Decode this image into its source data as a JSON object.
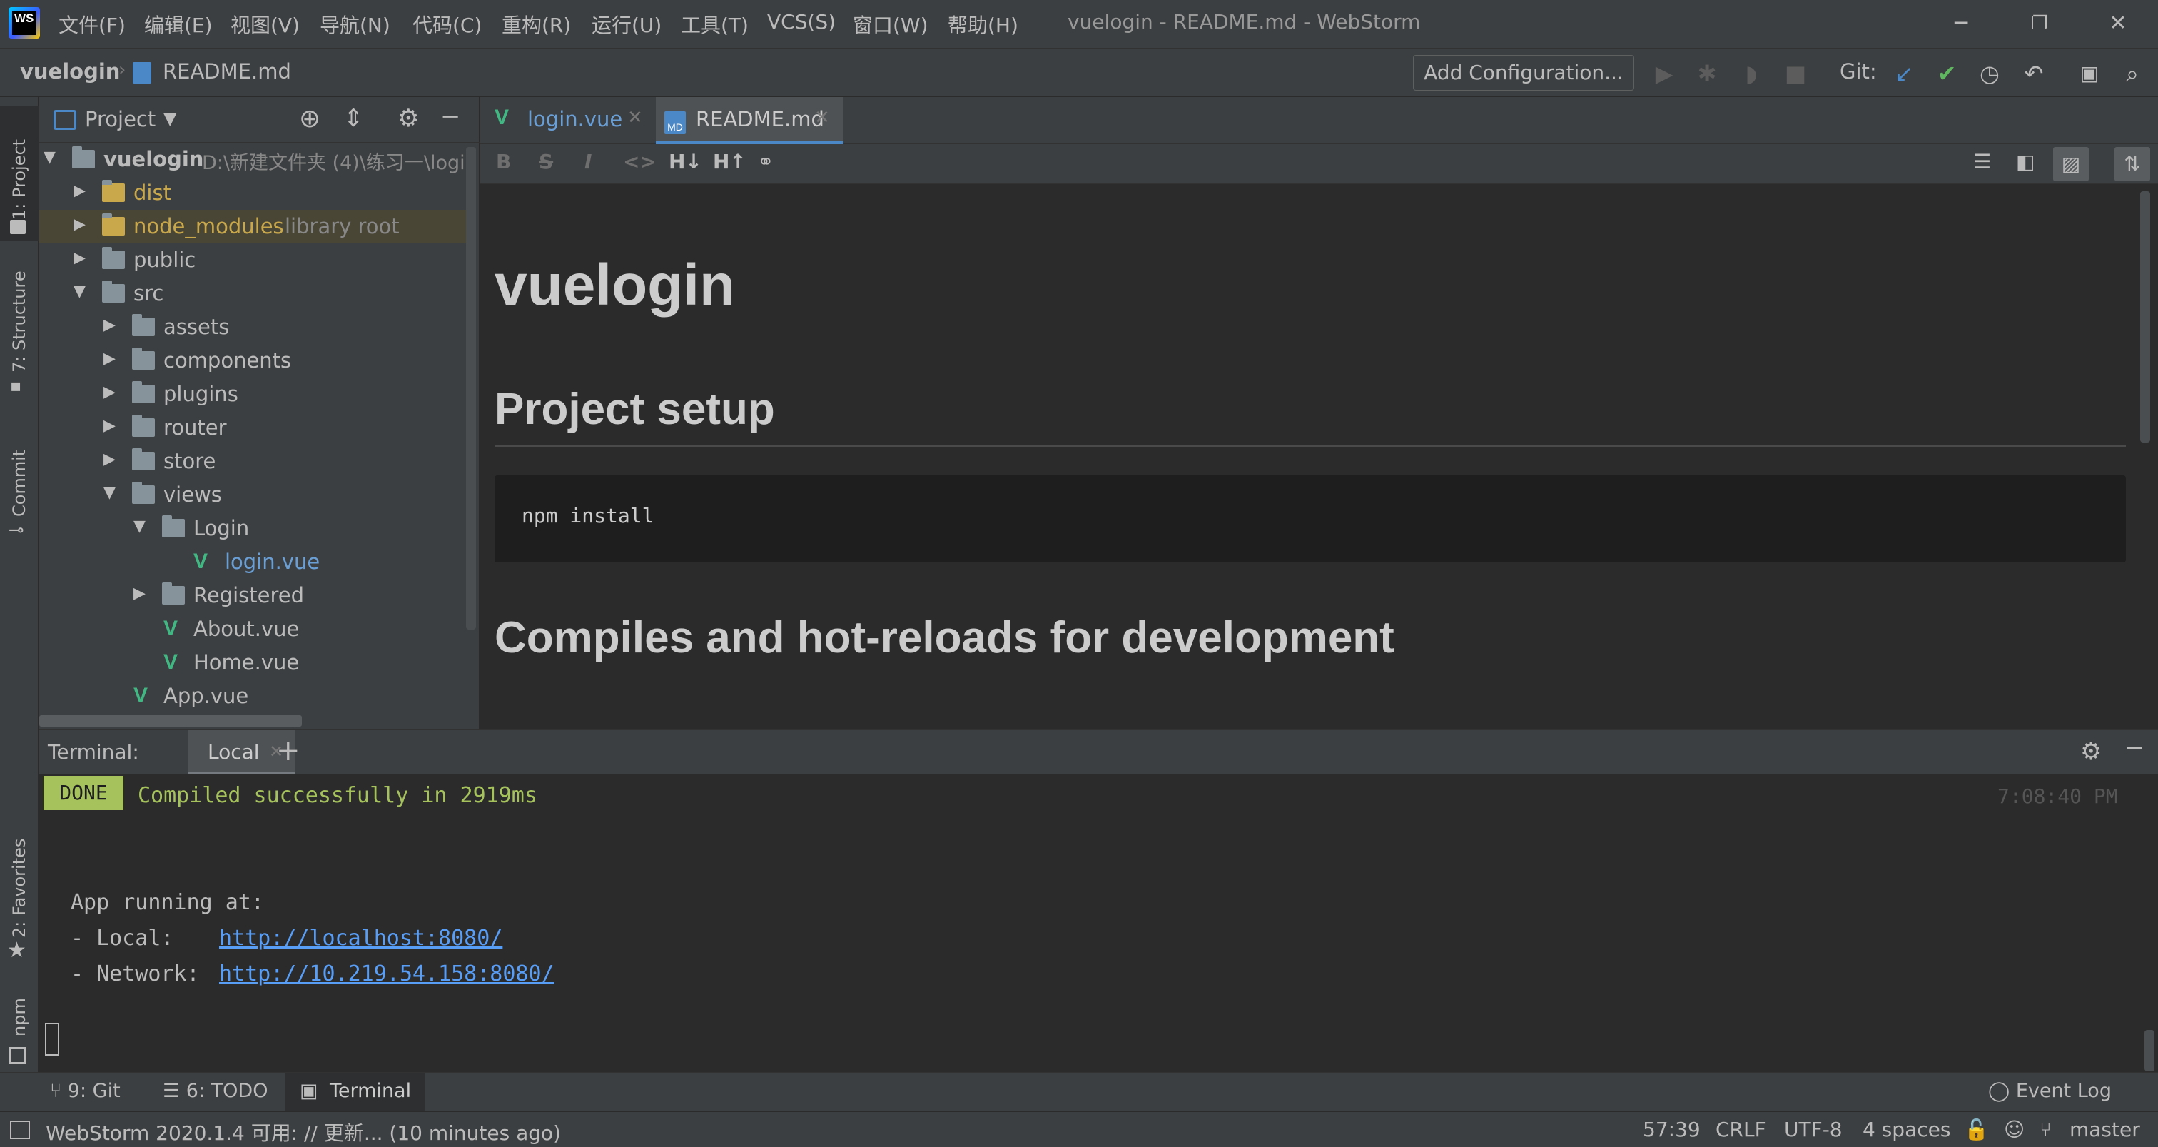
{
  "menu": [
    "文件(F)",
    "编辑(E)",
    "视图(V)",
    "导航(N)",
    "代码(C)",
    "重构(R)",
    "运行(U)",
    "工具(T)",
    "VCS(S)",
    "窗口(W)",
    "帮助(H)"
  ],
  "window_title": "vuelogin - README.md - WebStorm",
  "logo_text": "WS",
  "breadcrumb": {
    "project": "vuelogin",
    "file": "README.md"
  },
  "toolbar": {
    "add_config": "Add Configuration...",
    "git_label": "Git:"
  },
  "left_stripe": {
    "project": "1: Project",
    "structure": "7: Structure",
    "commit": "Commit",
    "favorites": "2: Favorites",
    "npm": "npm"
  },
  "project_panel": {
    "title": "Project",
    "root": {
      "name": "vuelogin",
      "path": "D:\\新建文件夹 (4)\\练习一\\logi"
    },
    "items": [
      {
        "label": "dist",
        "extra": ""
      },
      {
        "label": "node_modules",
        "extra": "library root"
      },
      {
        "label": "public",
        "extra": ""
      },
      {
        "label": "src",
        "extra": ""
      },
      {
        "label": "assets",
        "extra": ""
      },
      {
        "label": "components",
        "extra": ""
      },
      {
        "label": "plugins",
        "extra": ""
      },
      {
        "label": "router",
        "extra": ""
      },
      {
        "label": "store",
        "extra": ""
      },
      {
        "label": "views",
        "extra": ""
      },
      {
        "label": "Login",
        "extra": ""
      },
      {
        "label": "login.vue",
        "extra": ""
      },
      {
        "label": "Registered",
        "extra": ""
      },
      {
        "label": "About.vue",
        "extra": ""
      },
      {
        "label": "Home.vue",
        "extra": ""
      },
      {
        "label": "App.vue",
        "extra": ""
      }
    ]
  },
  "editor_tabs": [
    {
      "label": "login.vue",
      "active": false
    },
    {
      "label": "README.md",
      "active": true
    }
  ],
  "md_icon_text": "MD",
  "md_toolbar": {
    "bold": "B",
    "strike": "S",
    "italic": "I",
    "code": "<>",
    "h_down": "H↓",
    "h_up": "H↑"
  },
  "readme": {
    "h1": "vuelogin",
    "h2_setup": "Project setup",
    "code": "npm install",
    "h2_compile": "Compiles and hot-reloads for development"
  },
  "terminal": {
    "label": "Terminal:",
    "tab": "Local",
    "done_badge": "DONE",
    "compiled": "Compiled successfully in 2919ms",
    "time": "7:08:40 PM",
    "running": "App running at:",
    "local_label": "- Local:   ",
    "local_url": "http://localhost:8080/",
    "network_label": "- Network: ",
    "network_url": "http://10.219.54.158:8080/"
  },
  "bottom_tabs": {
    "git": "9: Git",
    "todo": "6: TODO",
    "terminal": "Terminal",
    "event_log": "Event Log"
  },
  "status": {
    "message": "WebStorm 2020.1.4 可用: // 更新... (10 minutes ago)",
    "position": "57:39",
    "line_sep": "CRLF",
    "encoding": "UTF-8",
    "indent": "4 spaces",
    "branch": "master"
  },
  "colors": {
    "accent": "#4a88c7",
    "vue_green": "#41b883",
    "done_bg": "#a5c25c",
    "compiled_text": "#a5c25c",
    "link": "#589df6"
  }
}
